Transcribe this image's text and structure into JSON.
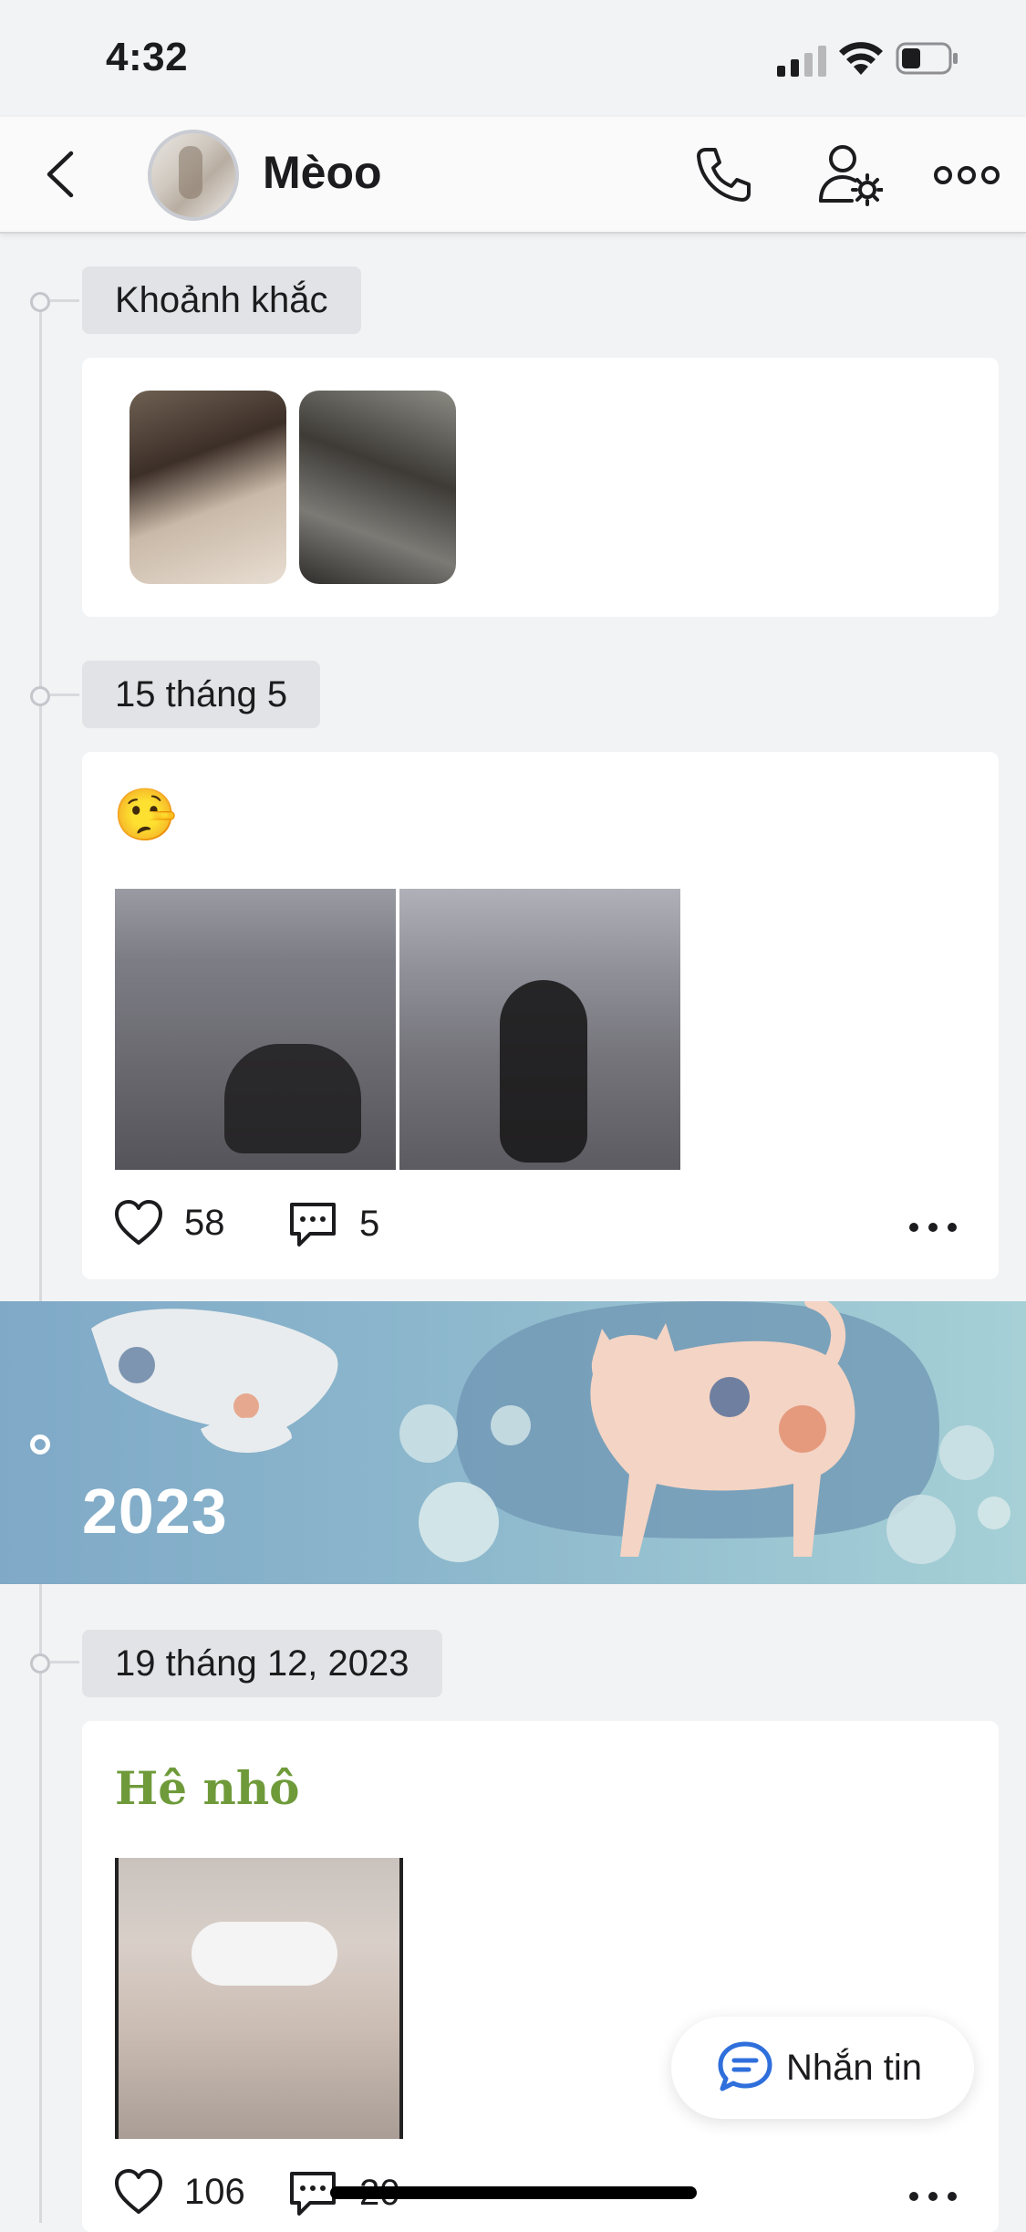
{
  "status_bar": {
    "time": "4:32"
  },
  "header": {
    "name": "Mèoo"
  },
  "timeline": {
    "moments": {
      "label": "Khoảnh khắc"
    },
    "post1": {
      "date": "15 tháng 5",
      "emoji": "🤥",
      "likes": "58",
      "comments": "5"
    },
    "year_banner": {
      "year": "2023"
    },
    "post2": {
      "date": "19 tháng 12, 2023",
      "caption": "Hê nhô",
      "likes": "106",
      "comments": "20"
    }
  },
  "chat_button": {
    "label": "Nhắn tin"
  },
  "colors": {
    "accent_blue": "#2f6fdc",
    "caption_green": "#6f9a3a",
    "banner_blue": "#8bb6cc"
  }
}
